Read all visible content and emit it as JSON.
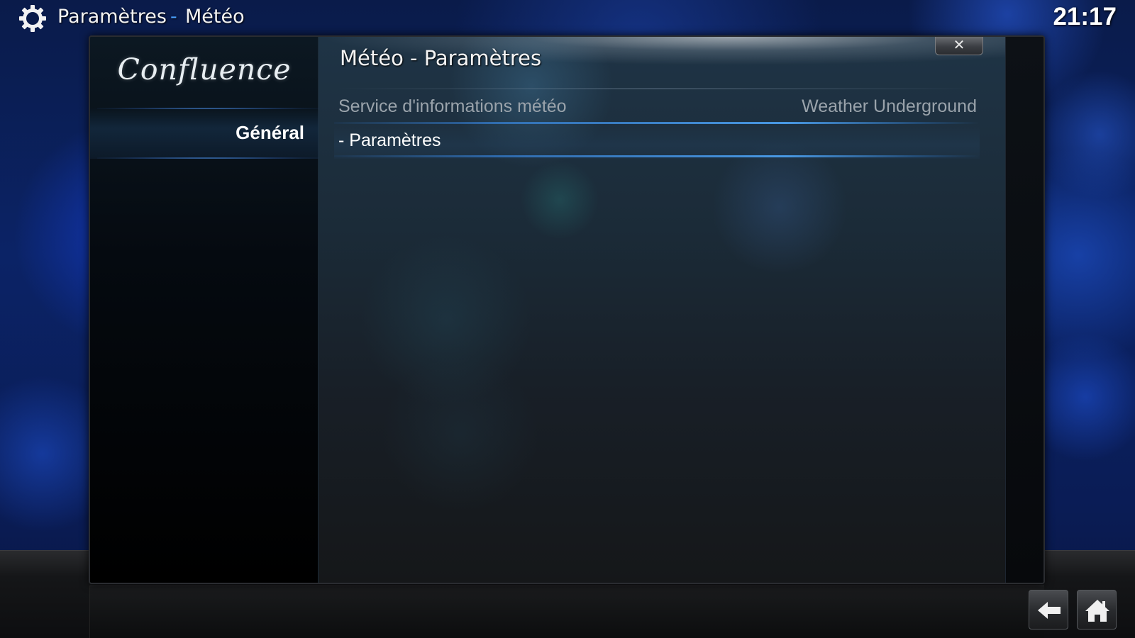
{
  "header": {
    "breadcrumb_root": "Paramètres",
    "breadcrumb_separator": "-",
    "breadcrumb_current": "Météo",
    "clock": "21:17",
    "icon": "gear-icon"
  },
  "sidebar": {
    "logo_text": "Confluence",
    "items": [
      {
        "label": "Général",
        "selected": true
      }
    ]
  },
  "dialog": {
    "title": "Météo - Paramètres",
    "close_label": "✕",
    "settings": [
      {
        "label": "Service d'informations météo",
        "value": "Weather Underground"
      },
      {
        "label": "- Paramètres",
        "value": ""
      }
    ]
  },
  "footer": {
    "back_icon": "back-arrow-icon",
    "home_icon": "home-icon"
  },
  "colors": {
    "accent": "#4aa0ff",
    "text_primary": "#ffffff",
    "text_secondary": "#9aa3ab"
  }
}
